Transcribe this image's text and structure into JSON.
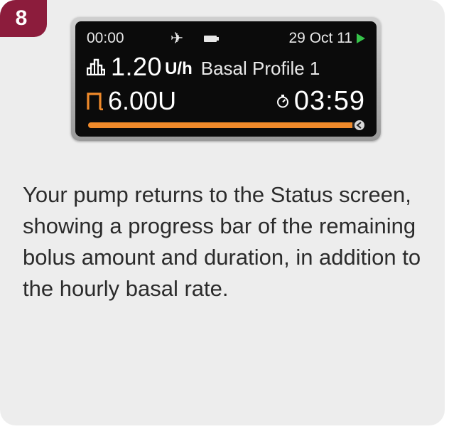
{
  "step": {
    "number": "8"
  },
  "device": {
    "status_bar": {
      "time": "00:00",
      "date": "29 Oct 11"
    },
    "basal": {
      "rate": "1.20",
      "unit": "U/h",
      "profile": "Basal Profile 1"
    },
    "bolus": {
      "amount": "6.00",
      "unit": "U",
      "remaining_time": "03:59"
    },
    "progress": {
      "fraction": 0.96
    },
    "icons": [
      "airplane-icon",
      "battery-icon",
      "play-icon",
      "basal-profile-icon",
      "extended-bolus-icon",
      "stopwatch-icon",
      "bolus-progress-end-icon"
    ]
  },
  "description": "Your pump returns to the Status screen, showing a progress bar of the remaining bolus amount and duration, in addition to the hourly basal rate.",
  "colors": {
    "badge": "#8c1c3c",
    "bolus_orange": "#f08a2a",
    "play_green": "#36c34a",
    "card_bg": "#ededed",
    "screen_bg": "#0b0b0b"
  }
}
